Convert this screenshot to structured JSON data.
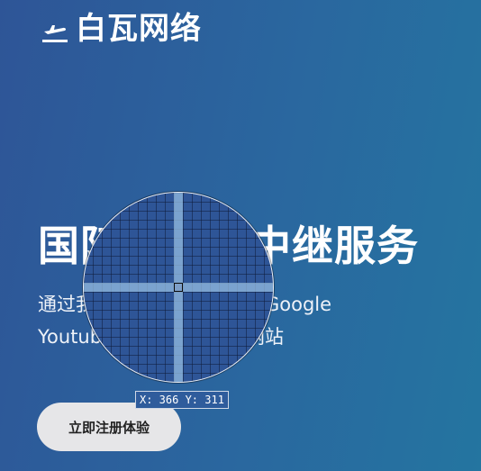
{
  "header": {
    "logo_icon": "airplane-takeoff-icon",
    "brand": "白瓦网络"
  },
  "hero": {
    "title": "国际互联网中继服务",
    "subtitle_line1": "通过我们的优化线路，访问Google",
    "subtitle_line2": "Youtube等海外各大知名网站",
    "cta_label": "立即注册体验"
  },
  "magnifier": {
    "coord_text": "X: 366 Y: 311"
  },
  "colors": {
    "background_start": "#2e5597",
    "background_end": "#2475a0",
    "cta_background": "#e6e6e8",
    "cta_text": "#222222"
  }
}
